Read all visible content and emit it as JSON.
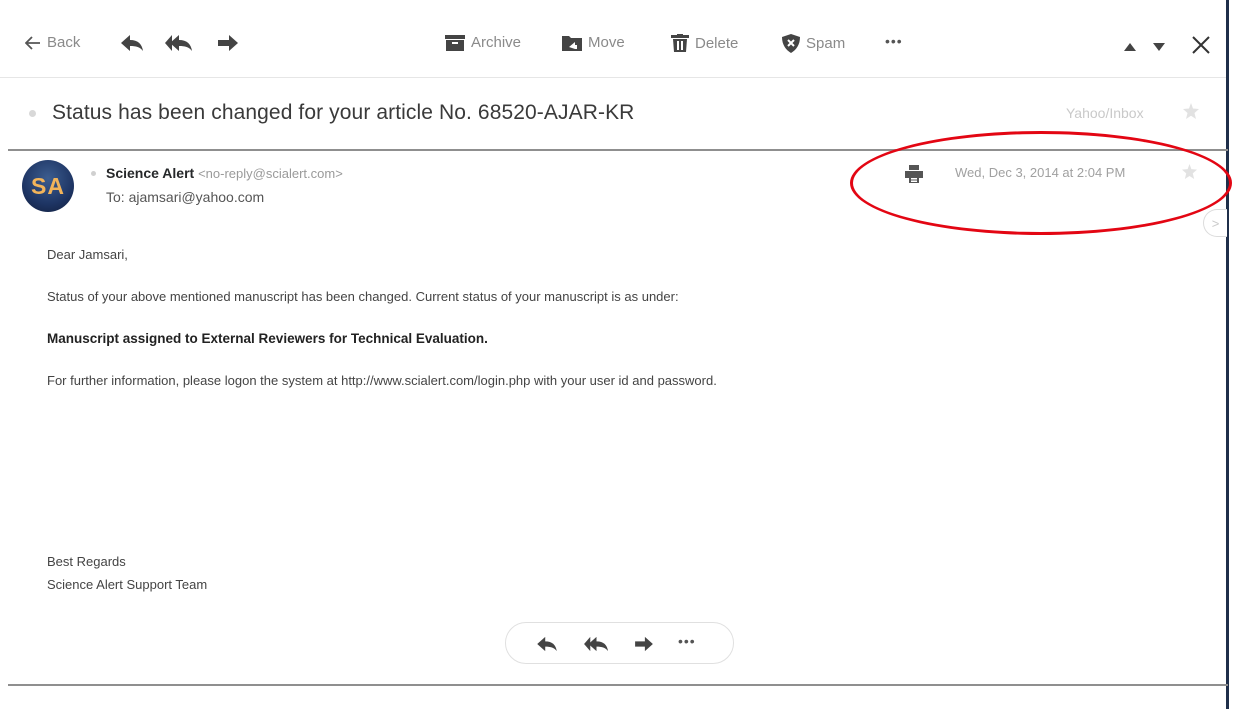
{
  "toolbar": {
    "back_label": "Back",
    "archive_label": "Archive",
    "move_label": "Move",
    "delete_label": "Delete",
    "spam_label": "Spam",
    "more_label": "•••"
  },
  "message": {
    "subject": "Status has been changed for your article No. 68520-AJAR-KR",
    "folder": "Yahoo/Inbox",
    "sender_initials": "SA",
    "sender_name": "Science Alert",
    "sender_email": "<no-reply@scialert.com>",
    "to": "To: ajamsari@yahoo.com",
    "date": "Wed, Dec 3, 2014 at 2:04 PM",
    "body": {
      "greeting": "Dear Jamsari,",
      "para1": "Status of your above mentioned manuscript has been changed. Current status of your manuscript is as under:",
      "status": "Manuscript assigned to External Reviewers for Technical Evaluation.",
      "para2": "For further information, please logon the system at http://www.scialert.com/login.php with your user id and password.",
      "sign_off": "Best Regards",
      "signature": "Science Alert Support Team"
    }
  },
  "reply_bar": {
    "more_label": "•••"
  },
  "scroll_handle_label": ">",
  "colors": {
    "annotation": "#e30613",
    "icon": "#444444",
    "avatar_text": "#f2b45a",
    "avatar_bg": "#1e3564"
  }
}
